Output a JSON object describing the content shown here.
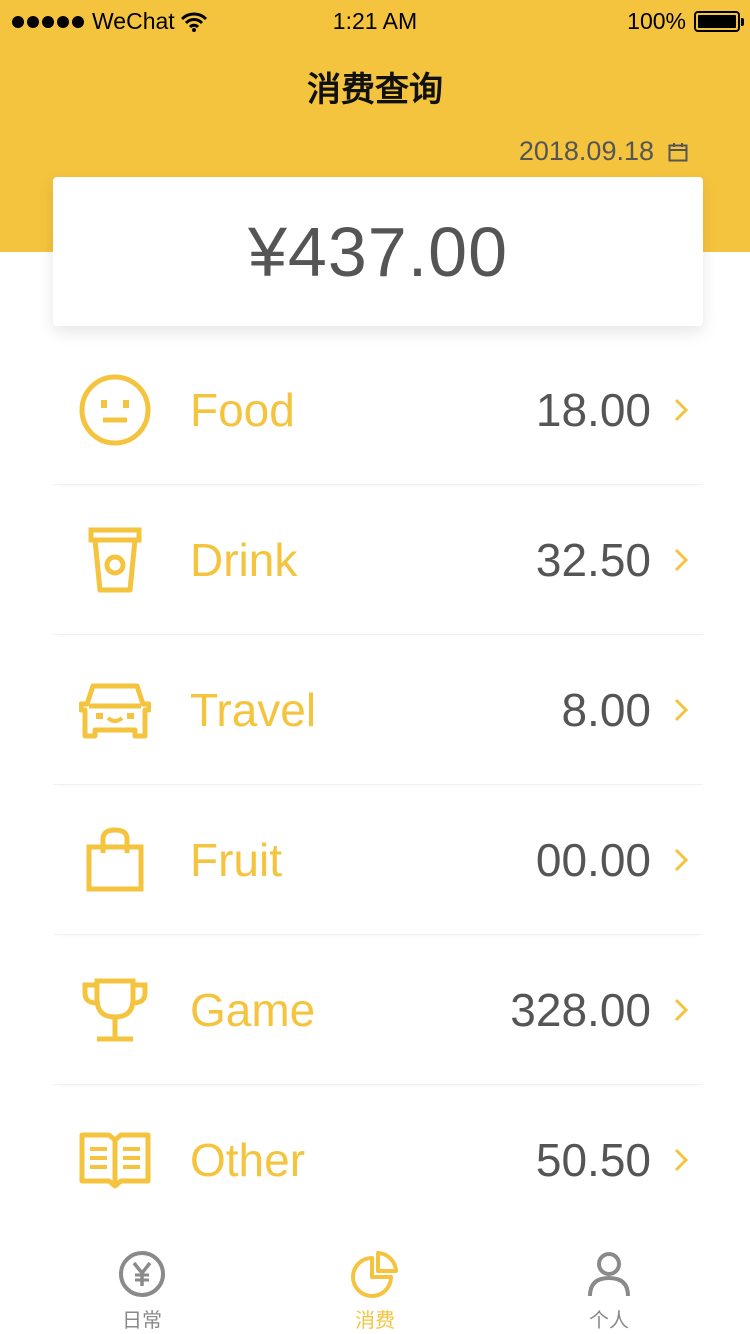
{
  "status_bar": {
    "carrier": "WeChat",
    "time": "1:21 AM",
    "battery": "100%"
  },
  "header": {
    "title": "消费查询",
    "date": "2018.09.18"
  },
  "summary": {
    "total": "¥437.00"
  },
  "categories": [
    {
      "name": "Food",
      "amount": "18.00",
      "icon": "neutral-face-icon"
    },
    {
      "name": "Drink",
      "amount": "32.50",
      "icon": "drink-cup-icon"
    },
    {
      "name": "Travel",
      "amount": "8.00",
      "icon": "car-icon"
    },
    {
      "name": "Fruit",
      "amount": "00.00",
      "icon": "shopping-bag-icon"
    },
    {
      "name": "Game",
      "amount": "328.00",
      "icon": "trophy-icon"
    },
    {
      "name": "Other",
      "amount": "50.50",
      "icon": "open-book-icon"
    }
  ],
  "tabbar": {
    "items": [
      {
        "label": "日常",
        "icon": "yen-coin-icon",
        "active": false
      },
      {
        "label": "消费",
        "icon": "pie-chart-icon",
        "active": true
      },
      {
        "label": "个人",
        "icon": "person-icon",
        "active": false
      }
    ]
  },
  "colors": {
    "accent": "#F5C43E",
    "text": "#555555",
    "inactive": "#8a8a8a"
  }
}
